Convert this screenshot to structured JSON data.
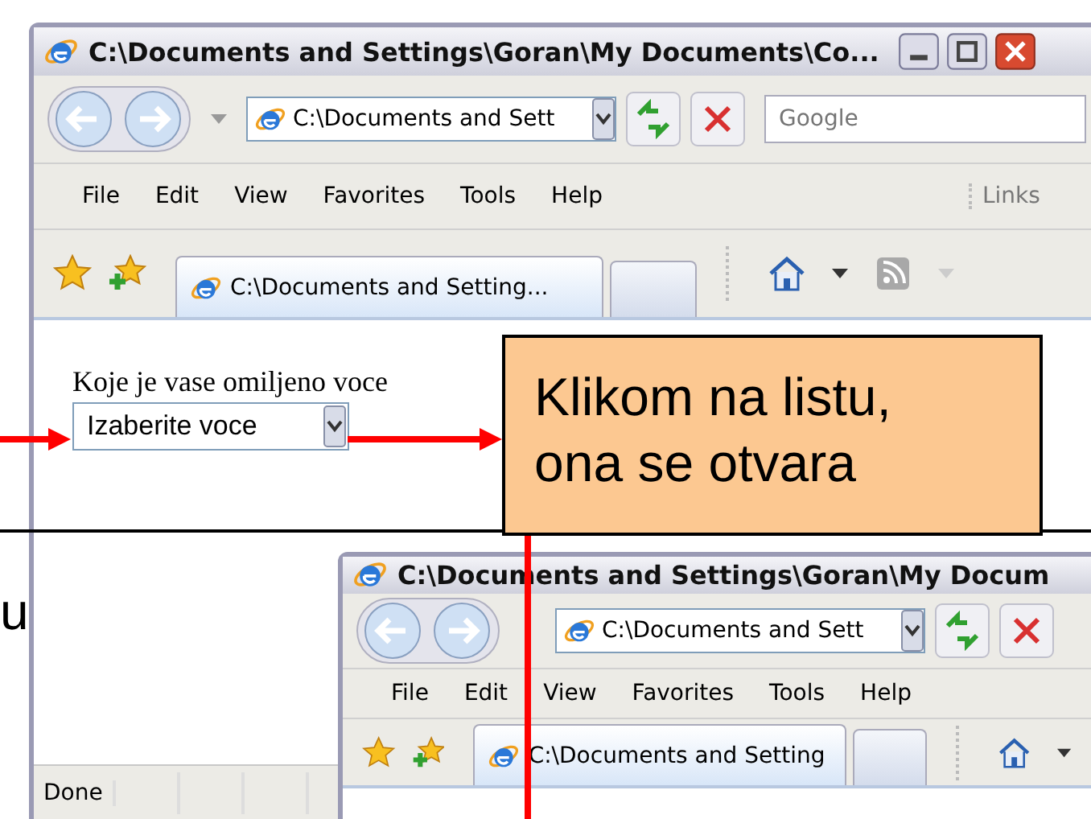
{
  "slide": {
    "cut_text": "u",
    "callout": {
      "text": "Klikom na listu, ona se otvara"
    }
  },
  "windows": [
    {
      "title": "C:\\Documents and Settings\\Goran\\My Documents\\Co...",
      "address": "C:\\Documents and Sett",
      "search": {
        "placeholder": "Google"
      },
      "menu": [
        "File",
        "Edit",
        "View",
        "Favorites",
        "Tools",
        "Help"
      ],
      "links": "Links",
      "tab": "C:\\Documents and Setting...",
      "content": {
        "question": "Koje je vase omiljeno voce",
        "select": "Izaberite voce"
      },
      "status": "Done"
    },
    {
      "title": "C:\\Documents and Settings\\Goran\\My Docum",
      "address": "C:\\Documents and Sett",
      "menu": [
        "File",
        "Edit",
        "View",
        "Favorites",
        "Tools",
        "Help"
      ],
      "tab": "C:\\Documents and Setting"
    }
  ]
}
